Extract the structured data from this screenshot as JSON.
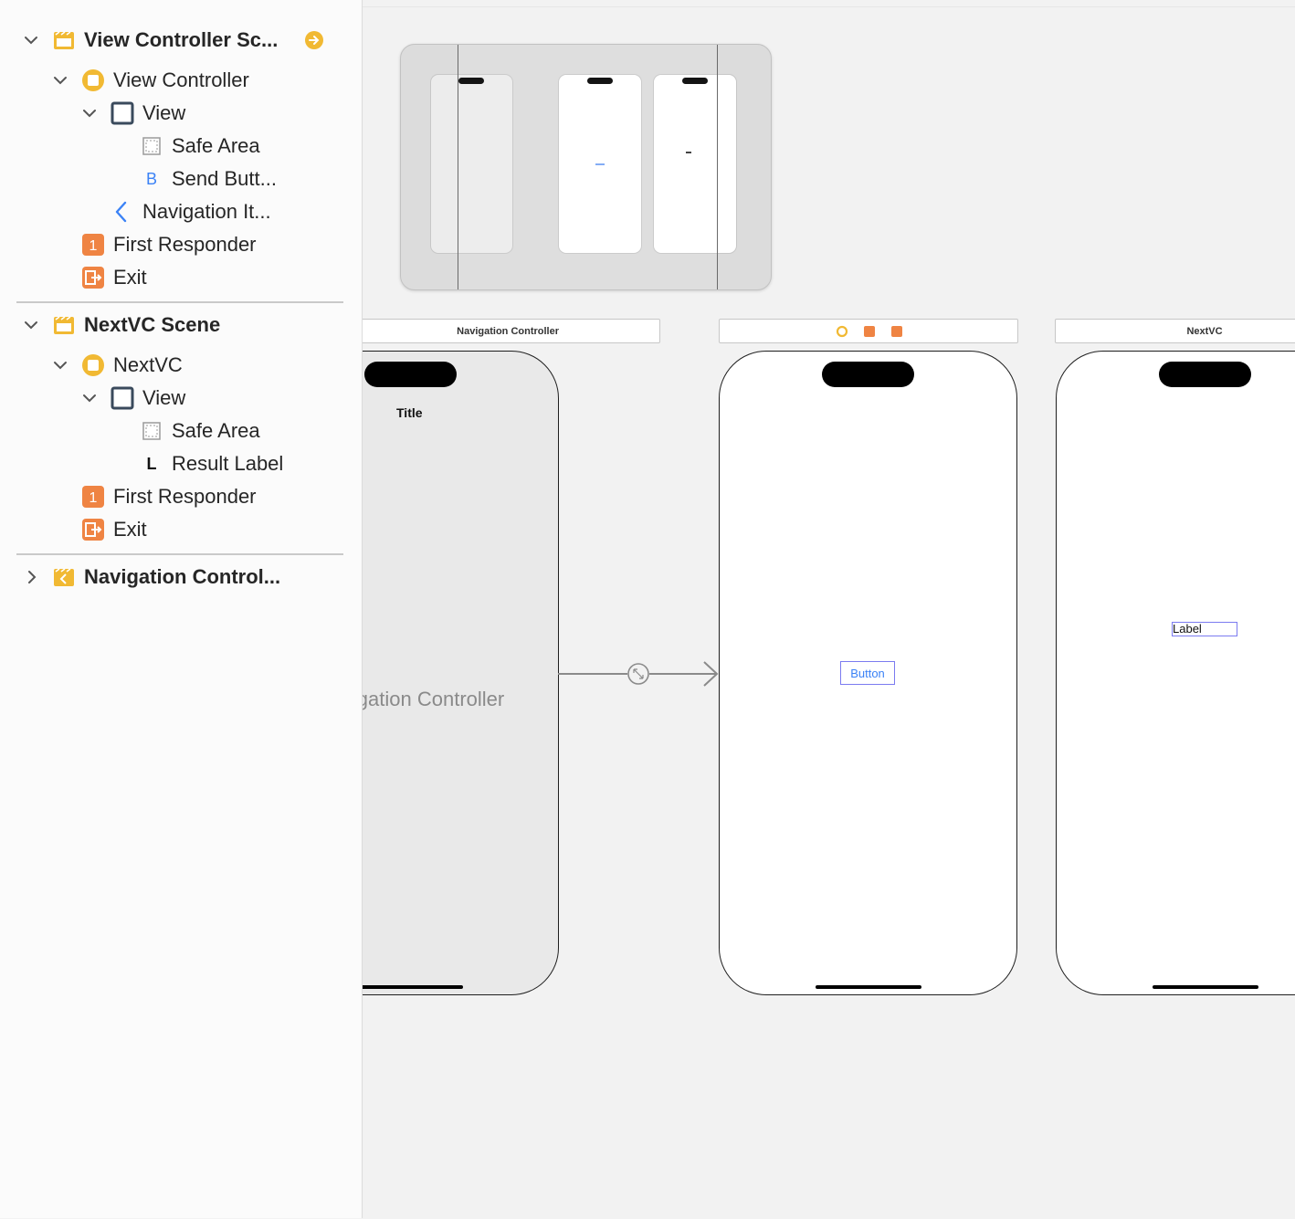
{
  "outline": {
    "items": [
      {
        "label": "View Controller Sc...",
        "icon": "scene-icon"
      },
      {
        "label": "View Controller",
        "icon": "view-controller-icon"
      },
      {
        "label": "View",
        "icon": "view-icon"
      },
      {
        "label": "Safe Area",
        "icon": "safe-area-icon"
      },
      {
        "label": "Send Butt...",
        "icon": "button-icon",
        "glyph": "B"
      },
      {
        "label": "Navigation It...",
        "icon": "navigation-item-icon"
      },
      {
        "label": "First Responder",
        "icon": "first-responder-icon",
        "glyph": "1"
      },
      {
        "label": "Exit",
        "icon": "exit-icon"
      },
      {
        "label": "NextVC Scene",
        "icon": "scene-icon"
      },
      {
        "label": "NextVC",
        "icon": "view-controller-icon"
      },
      {
        "label": "View",
        "icon": "view-icon"
      },
      {
        "label": "Safe Area",
        "icon": "safe-area-icon"
      },
      {
        "label": "Result Label",
        "icon": "label-icon",
        "glyph": "L"
      },
      {
        "label": "First Responder",
        "icon": "first-responder-icon",
        "glyph": "1"
      },
      {
        "label": "Exit",
        "icon": "exit-icon"
      },
      {
        "label": "Navigation Control...",
        "icon": "scene-icon"
      }
    ]
  },
  "canvas": {
    "nav_scene_title": "Navigation Controller",
    "nav_bar_title": "Title",
    "nav_placeholder": "Navigation Controller",
    "nextvc_scene_title": "NextVC",
    "button_title": "Button",
    "label_text": "Label",
    "segue_icon": "segue-icon"
  },
  "colors": {
    "accent_yellow": "#f1b933",
    "accent_orange": "#ef8443",
    "button_blue": "#3b82f6",
    "selection_border": "#7b7bf0"
  }
}
